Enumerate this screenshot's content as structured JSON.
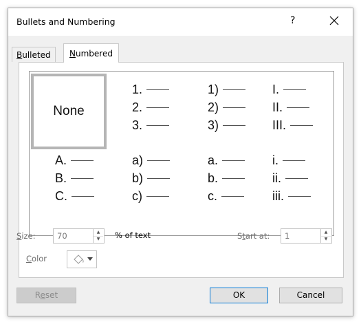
{
  "dialog": {
    "title": "Bullets and Numbering",
    "help": "?"
  },
  "tabs": [
    {
      "label": "Bulleted",
      "mnemonic": "B",
      "rest": "ulleted",
      "selected": false
    },
    {
      "label": "Numbered",
      "mnemonic": "N",
      "rest": "umbered",
      "selected": true
    }
  ],
  "gallery": {
    "none_label": "None",
    "row1": [
      [
        "1.",
        "2.",
        "3."
      ],
      [
        "1)",
        "2)",
        "3)"
      ],
      [
        "I.",
        "II.",
        "III."
      ]
    ],
    "row2": [
      [
        "A.",
        "B.",
        "C."
      ],
      [
        "a)",
        "b)",
        "c)"
      ],
      [
        "a.",
        "b.",
        "c."
      ],
      [
        "i.",
        "ii.",
        "iii."
      ]
    ]
  },
  "size": {
    "label_m": "S",
    "label_rest": "ize:",
    "value": "70",
    "suffix": "% of text"
  },
  "start_at": {
    "label_a": "S",
    "label_m": "t",
    "label_rest": "art at:",
    "value": "1"
  },
  "color": {
    "label_m": "C",
    "label_rest": "olor",
    "icon": "paint-bucket-icon"
  },
  "buttons": {
    "reset_a": "R",
    "reset_m": "e",
    "reset_rest": "set",
    "ok": "OK",
    "cancel": "Cancel"
  },
  "colors": {
    "accent": "#0078d7",
    "selected_border": "#b5b5b5"
  }
}
